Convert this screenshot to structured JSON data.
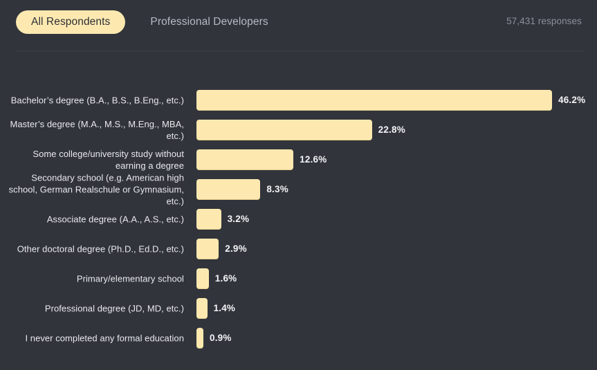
{
  "header": {
    "tabs": [
      {
        "label": "All Respondents",
        "active": true
      },
      {
        "label": "Professional Developers",
        "active": false
      }
    ],
    "responses": "57,431 responses"
  },
  "colors": {
    "background": "#31343b",
    "bar": "#fde9b0",
    "active_tab_bg": "#fde9b0",
    "active_tab_text": "#2d2f36",
    "inactive_tab_text": "#b6bac2",
    "label_text": "#e7e9ec",
    "value_text": "#f2f4f6",
    "responses_text": "#8b9098",
    "divider": "#3c4047"
  },
  "chart_data": {
    "type": "bar",
    "orientation": "horizontal",
    "title": "",
    "subtitle": "",
    "xlabel": "",
    "ylabel": "",
    "xlim": [
      0,
      46.2
    ],
    "grid": false,
    "legend": false,
    "value_suffix": "%",
    "categories": [
      "Bachelor’s degree (B.A., B.S., B.Eng., etc.)",
      "Master’s degree (M.A., M.S., M.Eng., MBA, etc.)",
      "Some college/university study without earning a degree",
      "Secondary school (e.g. American high school, German Realschule or Gymnasium, etc.)",
      "Associate degree (A.A., A.S., etc.)",
      "Other doctoral degree (Ph.D., Ed.D., etc.)",
      "Primary/elementary school",
      "Professional degree (JD, MD, etc.)",
      "I never completed any formal education"
    ],
    "values": [
      46.2,
      22.8,
      12.6,
      8.3,
      3.2,
      2.9,
      1.6,
      1.4,
      0.9
    ],
    "value_labels": [
      "46.2%",
      "22.8%",
      "12.6%",
      "8.3%",
      "3.2%",
      "2.9%",
      "1.6%",
      "1.4%",
      "0.9%"
    ]
  }
}
